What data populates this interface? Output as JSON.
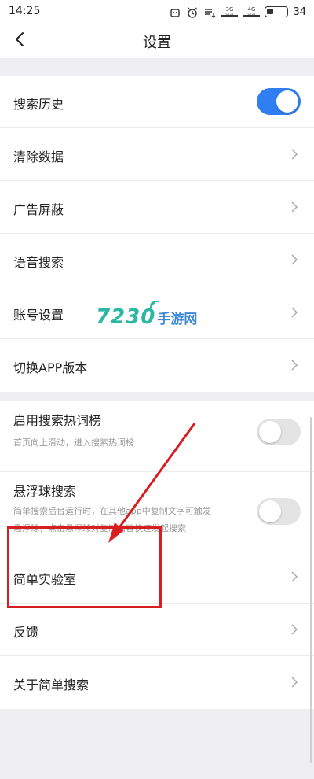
{
  "status_bar": {
    "time": "14:25",
    "net1": "3G",
    "net2": "4G",
    "sig_label": "SIGN",
    "battery": "34",
    "icons": [
      "android-icon",
      "alarm-icon",
      "data-arrows-icon",
      "signal-icon",
      "signal-icon",
      "battery-icon"
    ]
  },
  "header": {
    "title": "设置",
    "back_icon": "back-chevron-icon"
  },
  "groups": {
    "g1": {
      "search_history": "搜索历史",
      "clear_data": "清除数据",
      "ad_block": "广告屏蔽",
      "voice_search": "语音搜索",
      "account": "账号设置",
      "switch_version": "切换APP版本"
    },
    "g2": {
      "hot_words": "启用搜索热词榜",
      "hot_words_desc": "首页向上滑动，进入搜索热词榜",
      "float_ball": "悬浮球搜索",
      "float_ball_desc1": "简单搜索后台运行时，在其他app中复制文字可触发",
      "float_ball_desc2": "悬浮球，点击悬浮球对复制内容快速发起搜索"
    },
    "g3": {
      "lab": "简单实验室",
      "feedback": "反馈",
      "about": "关于简单搜索"
    }
  },
  "toggles": {
    "search_history": true,
    "hot_words": false,
    "float_ball": false
  },
  "watermark": {
    "number": "7230",
    "text": "手游网"
  },
  "colors": {
    "toggle_on": "#2f7ef2",
    "annotation": "#d81e1e",
    "watermark_green": "#2bb7a3",
    "watermark_blue": "#3f89d8"
  }
}
